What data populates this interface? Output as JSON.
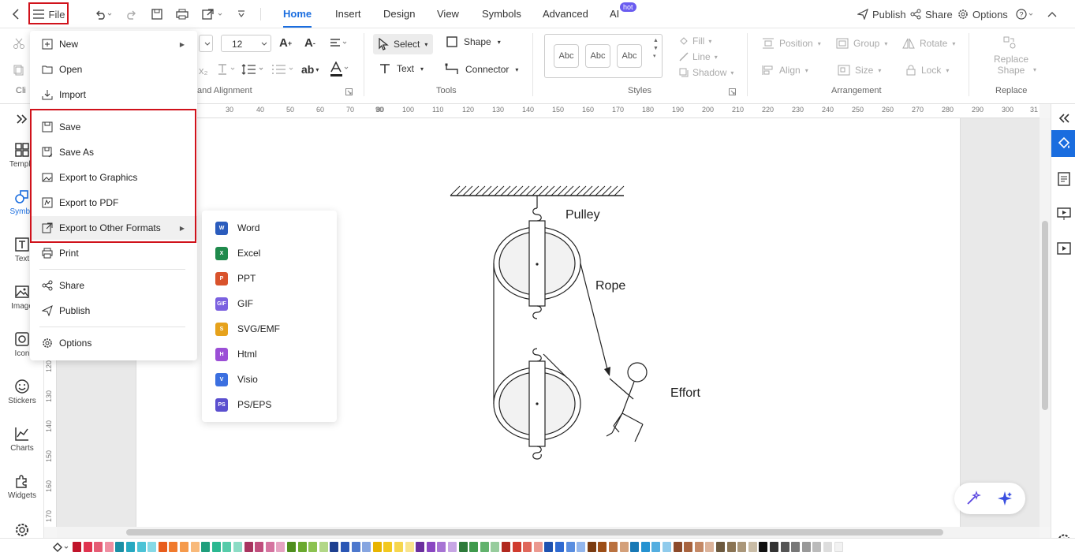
{
  "topbar": {
    "file_label": "File",
    "tabs": [
      "Home",
      "Insert",
      "Design",
      "View",
      "Symbols",
      "Advanced",
      "AI"
    ],
    "ai_badge": "hot",
    "publish_label": "Publish",
    "share_label": "Share",
    "options_label": "Options"
  },
  "ribbon": {
    "font_size": "12",
    "group_font_align": "and Alignment",
    "group_tools": "Tools",
    "group_styles": "Styles",
    "group_arrangement": "Arrangement",
    "group_replace": "Replace",
    "group_clip": "Cli",
    "select_label": "Select",
    "shape_label": "Shape",
    "text_label": "Text",
    "connector_label": "Connector",
    "style_samples": [
      "Abc",
      "Abc",
      "Abc"
    ],
    "fill_label": "Fill",
    "line_label": "Line",
    "shadow_label": "Shadow",
    "position_label": "Position",
    "group_label": "Group",
    "rotate_label": "Rotate",
    "align_label": "Align",
    "size_label": "Size",
    "lock_label": "Lock",
    "replace_shape_label": "Replace Shape"
  },
  "ruler": {
    "h_ticks": [
      "30",
      "40",
      "50",
      "60",
      "70",
      "80",
      "90",
      "100",
      "110",
      "120",
      "130",
      "140",
      "150",
      "160",
      "170",
      "180",
      "190",
      "200",
      "210",
      "220",
      "230",
      "240",
      "250",
      "260",
      "270",
      "280",
      "290",
      "300",
      "31"
    ],
    "v_ticks": [
      "120",
      "130",
      "140",
      "150",
      "160",
      "170"
    ]
  },
  "leftbar": {
    "items": [
      "Templa",
      "Symbo",
      "Text",
      "Image",
      "Icon",
      "Stickers",
      "Charts",
      "Widgets"
    ]
  },
  "file_menu": {
    "items": [
      "New",
      "Open",
      "Import",
      "Save",
      "Save As",
      "Export to Graphics",
      "Export to PDF",
      "Export to Other Formats",
      "Print",
      "Share",
      "Publish",
      "Options"
    ]
  },
  "export_submenu": {
    "items": [
      {
        "label": "Word",
        "color": "#2b5cbd",
        "letter": "W"
      },
      {
        "label": "Excel",
        "color": "#1f8a4c",
        "letter": "X"
      },
      {
        "label": "PPT",
        "color": "#d9532c",
        "letter": "P"
      },
      {
        "label": "GIF",
        "color": "#7b61e0",
        "letter": "GIF"
      },
      {
        "label": "SVG/EMF",
        "color": "#e6a21c",
        "letter": "S"
      },
      {
        "label": "Html",
        "color": "#9b4fd6",
        "letter": "H"
      },
      {
        "label": "Visio",
        "color": "#3b6fe0",
        "letter": "V"
      },
      {
        "label": "PS/EPS",
        "color": "#5b4fcf",
        "letter": "PS"
      }
    ]
  },
  "diagram": {
    "pulley_label": "Pulley",
    "rope_label": "Rope",
    "effort_label": "Effort"
  },
  "palette_colors": [
    "#c0142a",
    "#e0334f",
    "#e55b74",
    "#ef8ea1",
    "#1b8fa5",
    "#27a9c1",
    "#4cc3d6",
    "#86d9e6",
    "#e85c1b",
    "#f07a2d",
    "#f59a4c",
    "#f8b97a",
    "#1e9e7c",
    "#2bb891",
    "#55cba9",
    "#8cdcc5",
    "#a8345f",
    "#c04e7d",
    "#d574a0",
    "#e6a3c2",
    "#4f8f1e",
    "#6aa92e",
    "#8cc251",
    "#b2d787",
    "#1d3f8f",
    "#2a56b5",
    "#4d78cd",
    "#86a5e0",
    "#e8b400",
    "#f2c81e",
    "#f6d64e",
    "#f9e48c",
    "#6b2f9e",
    "#8a47c2",
    "#a774d4",
    "#c7a6e4",
    "#2d7a3a",
    "#3f9a4d",
    "#62b26d",
    "#97cc9d",
    "#b1281e",
    "#d03b2e",
    "#e0665a",
    "#eb9990",
    "#1e52b0",
    "#2f6ad1",
    "#5a8ee0",
    "#93b6ec",
    "#7a3b10",
    "#9c4e17",
    "#ba7240",
    "#d4a07a",
    "#1778b5",
    "#2592d1",
    "#54aee0",
    "#8fcbec",
    "#8c4a2a",
    "#a8633e",
    "#c48966",
    "#dcb39a",
    "#6d5a3f",
    "#8a7454",
    "#aa977a",
    "#c9bca6",
    "#111111",
    "#333333",
    "#555555",
    "#777777",
    "#999999",
    "#bbbbbb",
    "#dddddd",
    "#f2f2f2"
  ]
}
